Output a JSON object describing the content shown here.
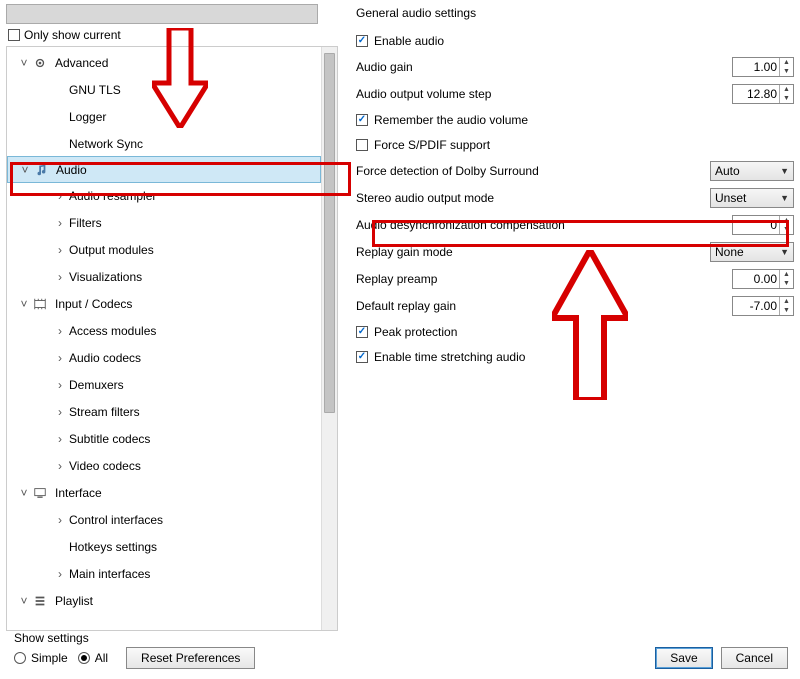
{
  "sidebar": {
    "only_show_current": "Only show current",
    "items": [
      {
        "kind": "cat",
        "label": "Advanced",
        "expanded": true,
        "icon": "gear"
      },
      {
        "kind": "leaf",
        "label": "GNU TLS"
      },
      {
        "kind": "leaf",
        "label": "Logger"
      },
      {
        "kind": "leaf",
        "label": "Network Sync"
      },
      {
        "kind": "cat",
        "label": "Audio",
        "expanded": true,
        "icon": "note",
        "selected": true
      },
      {
        "kind": "sub",
        "label": "Audio resampler"
      },
      {
        "kind": "sub",
        "label": "Filters"
      },
      {
        "kind": "sub",
        "label": "Output modules"
      },
      {
        "kind": "sub",
        "label": "Visualizations"
      },
      {
        "kind": "cat",
        "label": "Input / Codecs",
        "expanded": true,
        "icon": "codec"
      },
      {
        "kind": "sub",
        "label": "Access modules"
      },
      {
        "kind": "sub",
        "label": "Audio codecs"
      },
      {
        "kind": "sub",
        "label": "Demuxers"
      },
      {
        "kind": "sub",
        "label": "Stream filters"
      },
      {
        "kind": "sub",
        "label": "Subtitle codecs"
      },
      {
        "kind": "sub",
        "label": "Video codecs"
      },
      {
        "kind": "cat",
        "label": "Interface",
        "expanded": true,
        "icon": "iface"
      },
      {
        "kind": "sub",
        "label": "Control interfaces"
      },
      {
        "kind": "leaf",
        "label": "Hotkeys settings"
      },
      {
        "kind": "sub",
        "label": "Main interfaces"
      },
      {
        "kind": "cat",
        "label": "Playlist",
        "expanded": true,
        "icon": "list"
      },
      {
        "kind": "spacer"
      }
    ]
  },
  "settings": {
    "title": "General audio settings",
    "enable_audio": "Enable audio",
    "audio_gain": {
      "label": "Audio gain",
      "value": "1.00"
    },
    "volume_step": {
      "label": "Audio output volume step",
      "value": "12.80"
    },
    "remember_volume": "Remember the audio volume",
    "force_spdif": "Force S/PDIF support",
    "dolby": {
      "label": "Force detection of Dolby Surround",
      "value": "Auto"
    },
    "stereo_mode": {
      "label": "Stereo audio output mode",
      "value": "Unset"
    },
    "desync": {
      "label": "Audio desynchronization compensation",
      "value": "0"
    },
    "replay_mode": {
      "label": "Replay gain mode",
      "value": "None"
    },
    "replay_preamp": {
      "label": "Replay preamp",
      "value": "0.00"
    },
    "default_replay": {
      "label": "Default replay gain",
      "value": "-7.00"
    },
    "peak_protection": "Peak protection",
    "time_stretch": "Enable time stretching audio"
  },
  "footer": {
    "show_settings": "Show settings",
    "simple": "Simple",
    "all": "All",
    "reset": "Reset Preferences",
    "save": "Save",
    "cancel": "Cancel"
  }
}
